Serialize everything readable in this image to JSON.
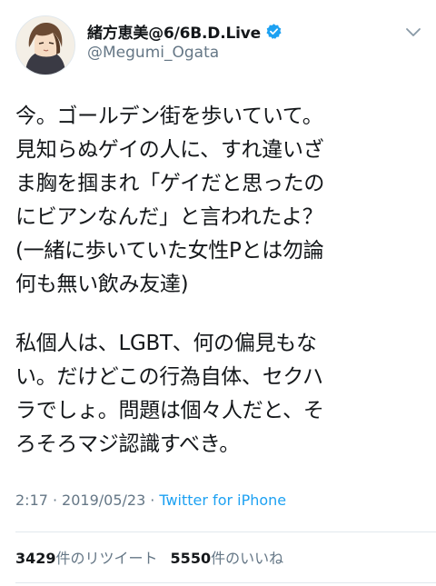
{
  "tweet": {
    "display_name": "緒方恵美@6/6B.D.Live",
    "handle": "@Megumi_Ogata",
    "avatar_icon": "user-avatar",
    "verified_icon": "verified-badge-icon",
    "menu_icon": "chevron-down-icon",
    "body": {
      "paragraph1": [
        "今。ゴールデン街を歩いていて。",
        "見知らぬゲイの人に、すれ違いざ",
        "ま胸を掴まれ「ゲイだと思ったの",
        "にビアンなんだ」と言われたよ？",
        "(一緒に歩いていた女性Pとは勿論",
        "何も無い飲み友達)"
      ],
      "paragraph2": [
        "私個人は、LGBT、何の偏見もな",
        "い。だけどこの行為自体、セクハ",
        "ラでしょ。問題は個々人だと、そ",
        "ろそろマジ認識すべき。"
      ]
    },
    "meta": {
      "time": "2:17",
      "separator": "·",
      "date": "2019/05/23",
      "source": "Twitter for iPhone"
    },
    "stats": {
      "retweets_count": "3429",
      "retweets_label": "件のリツイート",
      "likes_count": "5550",
      "likes_label": "件のいいね"
    }
  },
  "colors": {
    "text": "#14171a",
    "secondary": "#657786",
    "link": "#1da1f2",
    "divider": "#e1e8ed",
    "verified": "#1da1f2"
  }
}
